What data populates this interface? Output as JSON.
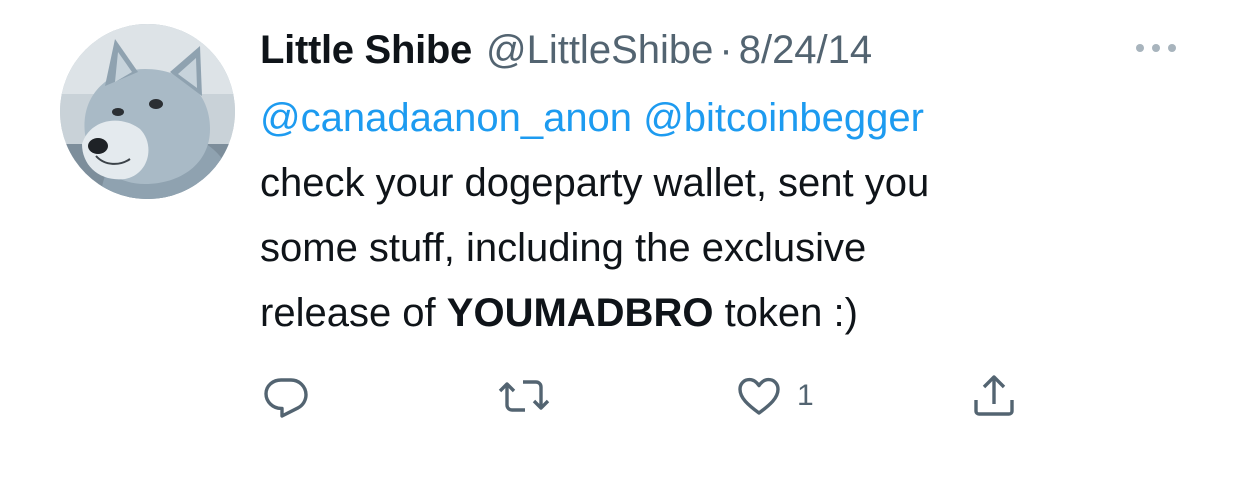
{
  "author": {
    "display_name": "Little Shibe",
    "handle": "@LittleShibe",
    "separator": "·",
    "date": "8/24/14",
    "avatar_icon": "doge-avatar"
  },
  "tweet": {
    "mention_1": "@canadaanon_anon",
    "mention_2": "@bitcoinbegger",
    "text_line_1": "check your dogeparty wallet, sent you",
    "text_line_2": "some stuff, including the exclusive",
    "text_line_3_start": "release of ",
    "text_line_3_bold": "YOUMADBRO",
    "text_line_3_end": " token :)"
  },
  "actions": {
    "reply_icon": "reply-icon",
    "retweet_icon": "retweet-icon",
    "like_icon": "heart-icon",
    "like_count": "1",
    "share_icon": "share-icon"
  },
  "colors": {
    "text": "#0f1419",
    "secondary": "#536471",
    "link": "#1d9bf0"
  }
}
